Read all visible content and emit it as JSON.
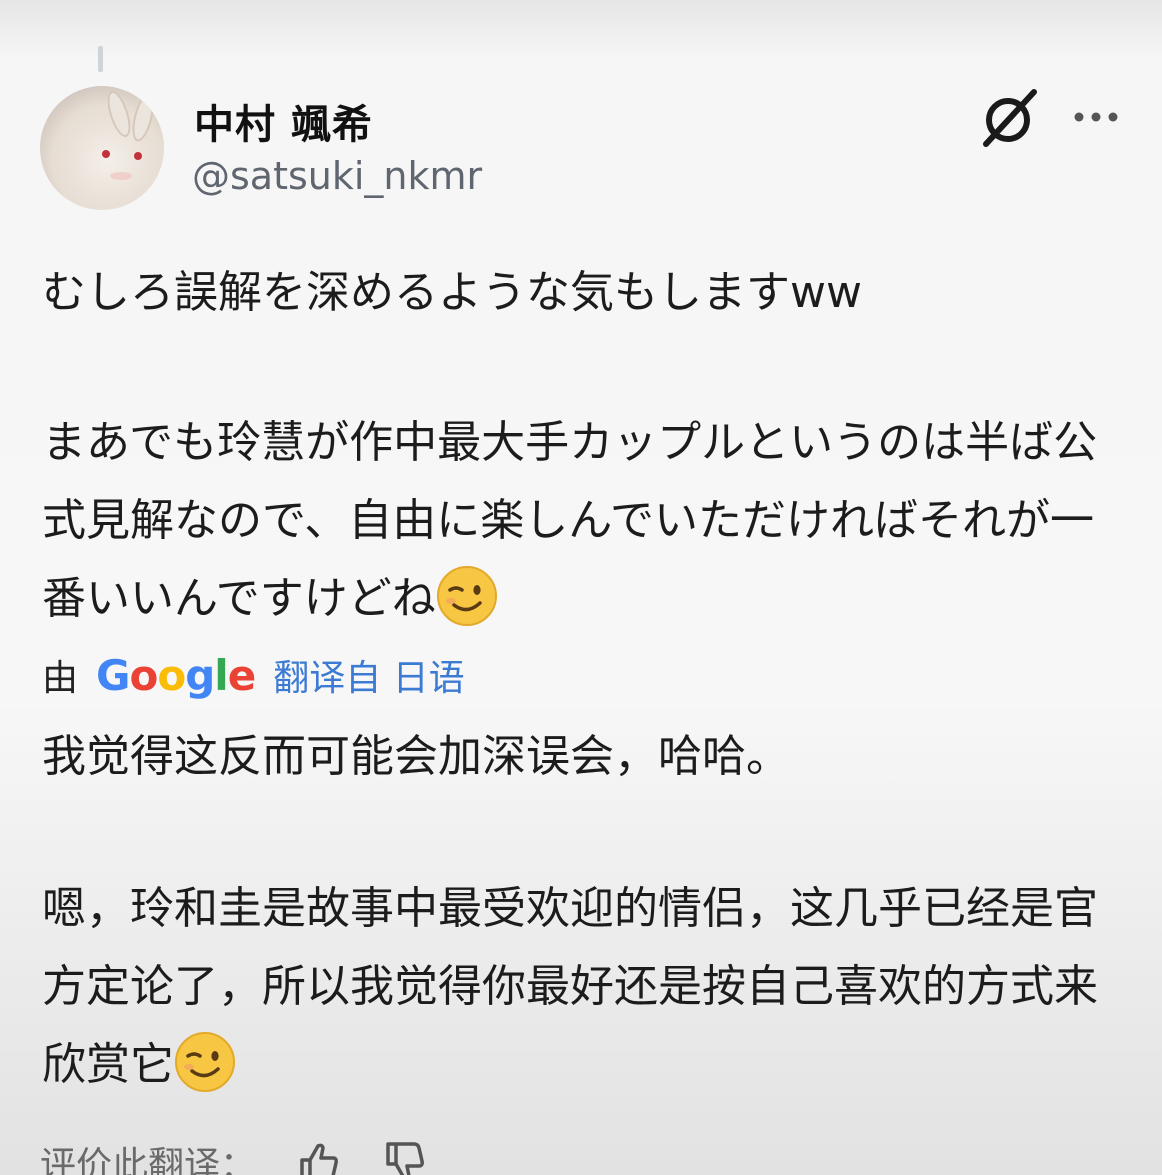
{
  "post": {
    "author_name": "中村 颯希",
    "author_handle": "@satsuki_nkmr",
    "original_text_1": "むしろ誤解を深めるような気もしますww",
    "original_text_2": "まあでも玲慧が作中最大手カップルというのは半ば公式見解なので、自由に楽しんでいただければそれが一番いいんですけどね",
    "translation_prefix": "由",
    "translation_service": "Google",
    "translation_label": "翻译自 日语",
    "translated_text_1": "我觉得这反而可能会加深误会，哈哈。",
    "translated_text_2": "嗯，玲和圭是故事中最受欢迎的情侣，这几乎已经是官方定论了，所以我觉得你最好还是按自己喜欢的方式来欣赏它",
    "rate_translation_label": "评价此翻译："
  },
  "icons": {
    "grok": "grok-slash-icon",
    "more": "more-dots-icon",
    "emoji": "winking-face-emoji",
    "thumbs_up": "thumbs-up-icon",
    "thumbs_down": "thumbs-down-icon"
  },
  "colors": {
    "link_blue": "#3b7bd4",
    "handle_gray": "#5f6670",
    "google_blue": "#4285f4",
    "google_red": "#ea4335",
    "google_yellow": "#fbbc05",
    "google_green": "#34a853"
  }
}
